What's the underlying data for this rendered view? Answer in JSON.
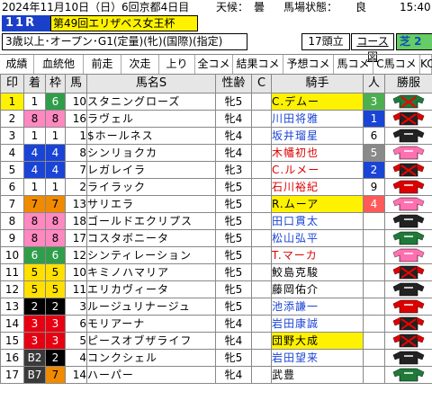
{
  "header": {
    "date": "2024年11月10日（日）",
    "meeting": "6回京都4日目",
    "weather_label": "天候：",
    "weather": "曇",
    "going_label": "馬場状態：",
    "going": "良",
    "post_time": "15:40",
    "race_no": "11R",
    "race_name": "第49回エリザベス女王杯",
    "conditions": "3歳以上･オープン･G1(定量)(牝)(国際)(指定)",
    "heads": "17頭立",
    "course_link": "コース図",
    "surface": "芝 2"
  },
  "menu": [
    "成績",
    "血統他",
    "前走",
    "次走",
    "上り",
    "全コメ",
    "結果コメ",
    "予想コメ",
    "馬コメ",
    "C馬コメ",
    "KO"
  ],
  "columns": [
    "印",
    "着",
    "枠",
    "馬",
    "馬名S",
    "性齢",
    "C",
    "騎手",
    "人",
    "勝服"
  ],
  "rows": [
    {
      "mark": "1",
      "rank": "1",
      "gate": "6",
      "no": "10",
      "name": "スタニングローズ",
      "sexage": "牝5",
      "c": "",
      "jockey": "C.デムー",
      "pop": "3",
      "silk": "grn-x"
    },
    {
      "mark": "2",
      "rank": "8",
      "gate": "8",
      "no": "16",
      "name": "ラヴェル",
      "sexage": "牝4",
      "c": "",
      "jockey": "川田将雅",
      "pop": "1",
      "silk": "blk-x"
    },
    {
      "mark": "3",
      "rank": "1",
      "gate": "1",
      "no": "1",
      "name": "$ホールネス",
      "sexage": "牝4",
      "c": "",
      "jockey": "坂井瑠星",
      "pop": "6",
      "silk": "blk"
    },
    {
      "mark": "4",
      "rank": "4",
      "gate": "4",
      "no": "8",
      "name": "シンリョクカ",
      "sexage": "牝4",
      "c": "",
      "jockey": "木幡初也",
      "pop": "5",
      "silk": "pink"
    },
    {
      "mark": "5",
      "rank": "4",
      "gate": "4",
      "no": "7",
      "name": "レガレイラ",
      "sexage": "牝3",
      "c": "",
      "jockey": "C.ルメー",
      "pop": "2",
      "silk": "blk-x"
    },
    {
      "mark": "6",
      "rank": "1",
      "gate": "1",
      "no": "2",
      "name": "ライラック",
      "sexage": "牝5",
      "c": "",
      "jockey": "石川裕紀",
      "pop": "9",
      "silk": "red"
    },
    {
      "mark": "7",
      "rank": "7",
      "gate": "7",
      "no": "13",
      "name": "サリエラ",
      "sexage": "牝5",
      "c": "",
      "jockey": "R.ムーア",
      "pop": "4",
      "silk": "pink"
    },
    {
      "mark": "8",
      "rank": "8",
      "gate": "8",
      "no": "18",
      "name": "ゴールドエクリプス",
      "sexage": "牝5",
      "c": "",
      "jockey": "田口貫太",
      "pop": "",
      "silk": "blk"
    },
    {
      "mark": "9",
      "rank": "8",
      "gate": "8",
      "no": "17",
      "name": "コスタボニータ",
      "sexage": "牝5",
      "c": "",
      "jockey": "松山弘平",
      "pop": "",
      "silk": "grn"
    },
    {
      "mark": "10",
      "rank": "6",
      "gate": "6",
      "no": "12",
      "name": "シンティレーション",
      "sexage": "牝5",
      "c": "",
      "jockey": "T.マーカ",
      "pop": "",
      "silk": "pink"
    },
    {
      "mark": "11",
      "rank": "5",
      "gate": "5",
      "no": "10",
      "name": "キミノハマリア",
      "sexage": "牝5",
      "c": "",
      "jockey": "鮫島克駿",
      "pop": "",
      "silk": "blk-x"
    },
    {
      "mark": "12",
      "rank": "5",
      "gate": "5",
      "no": "11",
      "name": "エリカヴィータ",
      "sexage": "牝5",
      "c": "",
      "jockey": "藤岡佑介",
      "pop": "",
      "silk": "blk"
    },
    {
      "mark": "13",
      "rank": "2",
      "gate": "2",
      "no": "3",
      "name": "ルージュリナージュ",
      "sexage": "牝5",
      "c": "",
      "jockey": "池添謙一",
      "pop": "",
      "silk": "red"
    },
    {
      "mark": "14",
      "rank": "3",
      "gate": "3",
      "no": "6",
      "name": "モリアーナ",
      "sexage": "牝4",
      "c": "",
      "jockey": "岩田康誠",
      "pop": "",
      "silk": "blk-x"
    },
    {
      "mark": "15",
      "rank": "3",
      "gate": "3",
      "no": "5",
      "name": "ピースオブザライフ",
      "sexage": "牝4",
      "c": "",
      "jockey": "団野大成",
      "pop": "",
      "silk": "blk-x"
    },
    {
      "mark": "16",
      "rank": "B2",
      "gate": "2",
      "no": "4",
      "name": "コンクシェル",
      "sexage": "牝5",
      "c": "",
      "jockey": "岩田望来",
      "pop": "",
      "silk": "blk"
    },
    {
      "mark": "17",
      "rank": "B7",
      "gate": "7",
      "no": "14",
      "name": "ハーパー",
      "sexage": "牝4",
      "c": "",
      "jockey": "武豊",
      "pop": "",
      "silk": "grn"
    }
  ],
  "colors": {
    "race_box": "#1a3fc8",
    "race_name_bg": "#fff200",
    "surface_bg": "#66cc66",
    "highlight": "#fff200",
    "jockey_blue": "#1a44d6",
    "popular_yellow": "#fff200"
  }
}
